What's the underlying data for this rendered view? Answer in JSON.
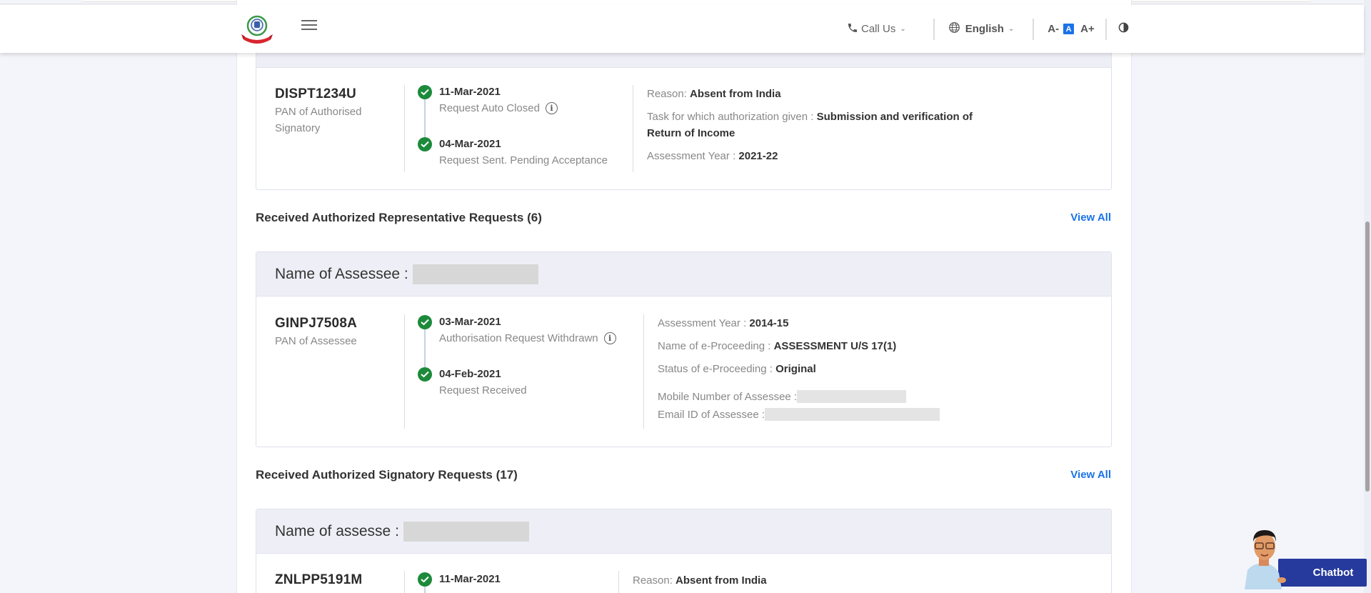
{
  "header": {
    "logo_alt": "Income Tax Department emblem",
    "menu_icon": "hamburger-icon",
    "call_us": "Call Us",
    "language": "English",
    "font_decrease": "A-",
    "font_default": "A",
    "font_increase": "A+",
    "contrast_icon": "contrast-icon"
  },
  "top_card": {
    "pan": "DISPT1234U",
    "pan_label": "PAN of Authorised Signatory",
    "timeline": [
      {
        "date": "11-Mar-2021",
        "desc": "Request Auto Closed",
        "info": true
      },
      {
        "date": "04-Mar-2021",
        "desc": "Request Sent. Pending Acceptance",
        "info": false
      }
    ],
    "details": {
      "reason_label": "Reason: ",
      "reason_value": "Absent from India",
      "task_label": "Task for which authorization given : ",
      "task_value": "Submission and verification of",
      "task_value_2": "Return of Income",
      "ay_label": "Assessment Year : ",
      "ay_value": "2021-22"
    }
  },
  "rep_section": {
    "title": "Received Authorized Representative Requests (6)",
    "view_all": "View All",
    "card": {
      "head_label": "Name of Assessee :",
      "pan": "GINPJ7508A",
      "pan_label": "PAN of Assessee",
      "timeline": [
        {
          "date": "03-Mar-2021",
          "desc": "Authorisation Request Withdrawn",
          "info": true
        },
        {
          "date": "04-Feb-2021",
          "desc": "Request Received",
          "info": false
        }
      ],
      "details": {
        "ay_label": "Assessment Year : ",
        "ay_value": "2014-15",
        "proc_label": "Name of e-Proceeding : ",
        "proc_value": "ASSESSMENT U/S 17(1)",
        "status_label": "Status of e-Proceeding : ",
        "status_value": "Original",
        "mobile_label": "Mobile Number of Assessee : ",
        "email_label": "Email ID of Assessee : "
      }
    }
  },
  "sig_section": {
    "title": "Received Authorized Signatory Requests (17)",
    "view_all": "View All",
    "card": {
      "head_label": "Name of assesse :",
      "pan": "ZNLPP5191M",
      "timeline": [
        {
          "date": "11-Mar-2021"
        }
      ],
      "details": {
        "reason_label": "Reason: ",
        "reason_value": "Absent from India"
      }
    }
  },
  "chatbot": {
    "label": "Chatbot"
  }
}
